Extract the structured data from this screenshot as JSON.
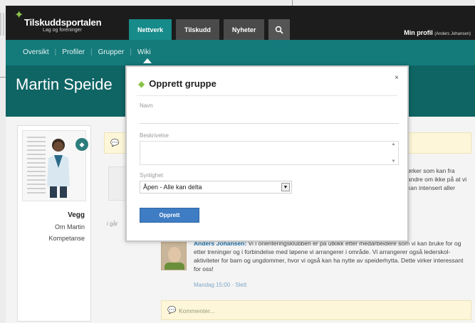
{
  "header": {
    "logo_title": "Tilskuddsportalen",
    "logo_subtitle": "Lag og foreninger",
    "tabs": [
      {
        "label": "Nettverk",
        "active": true
      },
      {
        "label": "Tilskudd",
        "active": false
      },
      {
        "label": "Nyheter",
        "active": false
      }
    ],
    "search_icon": "search-icon",
    "profile_label": "Min profil",
    "profile_user": "(Anders Johansen)"
  },
  "subnav": {
    "items": [
      "Oversikt",
      "Profiler",
      "Grupper",
      "Wiki"
    ]
  },
  "banner": {
    "name": "Martin Speide"
  },
  "sidebar": {
    "menu": [
      "Vegg",
      "Om Martin",
      "Kompetanse"
    ]
  },
  "feed": {
    "post_text": "ørker som kan fra andre om ikke på at vi kan intensert aller",
    "post_side": "i går",
    "comment": {
      "author": "Anders Johansen:",
      "text": "Vi i orienteringsklubben er på utkikk etter medarbeidere som vi kan bruke for og etter treninger og i forbindelse med løpene vi arrangerer i område. Vi arrangerer også lederskol-aktiviteter for barn og ungdommer, hvor vi også kan ha nytte av speiderhytta. Dette virker interessant for oss!",
      "meta": "Mandag 15:00 · Slett"
    },
    "comment_placeholder": "Kommenter..."
  },
  "modal": {
    "title": "Opprett gruppe",
    "close": "×",
    "fields": {
      "name_label": "Navn",
      "name_value": "",
      "description_label": "Beskrivelse",
      "description_value": "",
      "visibility_label": "Synlighet",
      "visibility_value": "Åpen - Alle kan delta"
    },
    "submit_label": "Opprett"
  },
  "colors": {
    "teal_active": "#178a8a",
    "teal_subnav": "#157a7a",
    "teal_banner": "#0f6464",
    "button_blue": "#3e7cc3",
    "notice_yellow": "#fdf6d9"
  }
}
